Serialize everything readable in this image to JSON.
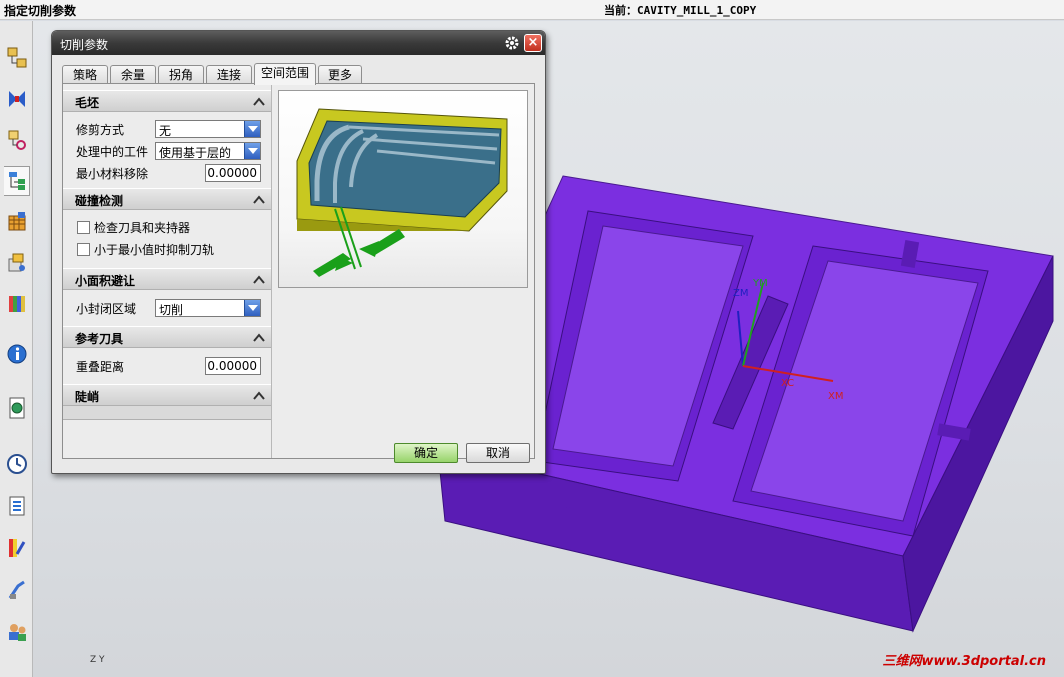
{
  "topbar": {
    "prompt": "指定切削参数",
    "current_label": "当前：",
    "current_op": "CAVITY_MILL_1_COPY"
  },
  "resource_bar": {
    "icons": [
      "assembly-navigator-icon",
      "constraint-navigator-icon",
      "part-navigator-icon",
      "operation-navigator-icon",
      "reuse-library-icon",
      "hd3d-tools-icon",
      "web-browser-icon",
      "information-icon",
      "palette-icon",
      "history-icon",
      "process-studio-icon",
      "visualization-icon",
      "manufacturing-wizard-icon",
      "roles-icon"
    ]
  },
  "dialog": {
    "title": "切削参数",
    "tabs": [
      {
        "label": "策略",
        "active": false
      },
      {
        "label": "余量",
        "active": false
      },
      {
        "label": "拐角",
        "active": false
      },
      {
        "label": "连接",
        "active": false
      },
      {
        "label": "空间范围",
        "active": true
      },
      {
        "label": "更多",
        "active": false
      }
    ],
    "groups": {
      "blank": {
        "title": "毛坯",
        "trim_label": "修剪方式",
        "trim_value": "无",
        "ipw_label": "处理中的工件",
        "ipw_value": "使用基于层的",
        "min_removal_label": "最小材料移除",
        "min_removal_value": "0.00000"
      },
      "collision": {
        "title": "碰撞检测",
        "check_holder_label": "检查刀具和夹持器",
        "suppress_label": "小于最小值时抑制刀轨"
      },
      "small_area": {
        "title": "小面积避让",
        "closed_area_label": "小封闭区域",
        "closed_area_value": "切削"
      },
      "ref_tool": {
        "title": "参考刀具",
        "overlap_label": "重叠距离",
        "overlap_value": "0.00000"
      },
      "steep": {
        "title": "陡峭"
      }
    },
    "ok_label": "确定",
    "cancel_label": "取消"
  },
  "viewport": {
    "part_color": "#7b2fe0",
    "axis_labels": {
      "zm": "ZM",
      "ym": "YM",
      "xc": "XC",
      "xm": "XM"
    },
    "triad_labels": {
      "z": "Z",
      "y": "Y"
    },
    "watermark": "三维网www.3dportal.cn"
  }
}
